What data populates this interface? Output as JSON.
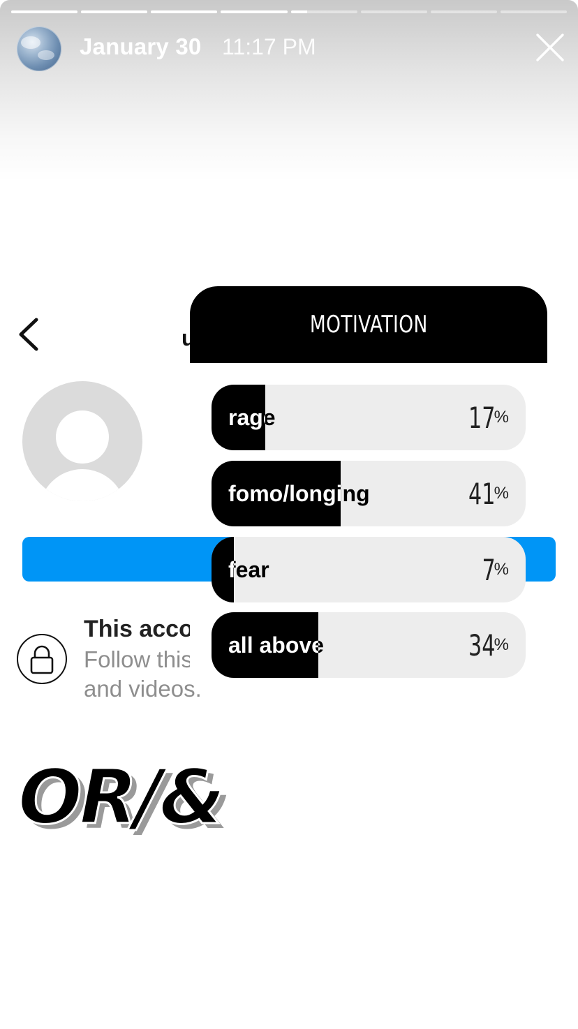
{
  "story": {
    "segments": [
      1,
      1,
      1,
      1,
      0.25,
      0,
      0,
      0
    ],
    "date": "January 30",
    "time": "11:17 PM"
  },
  "background_profile": {
    "username_fragment": "u",
    "private_title": "This account is private",
    "private_line1": "Follow this account to see their photos",
    "private_line2": "and videos."
  },
  "poll": {
    "title": "MOTIVATION",
    "options": [
      {
        "label": "rage",
        "percent": 17
      },
      {
        "label": "fomo/longing",
        "percent": 41
      },
      {
        "label": "fear",
        "percent": 7
      },
      {
        "label": "all above",
        "percent": 34
      }
    ],
    "percent_sign": "%"
  },
  "sticker_text": "OR/&",
  "colors": {
    "follow_blue": "#0095f6",
    "poll_fill": "#000000",
    "poll_track": "#ededed"
  }
}
